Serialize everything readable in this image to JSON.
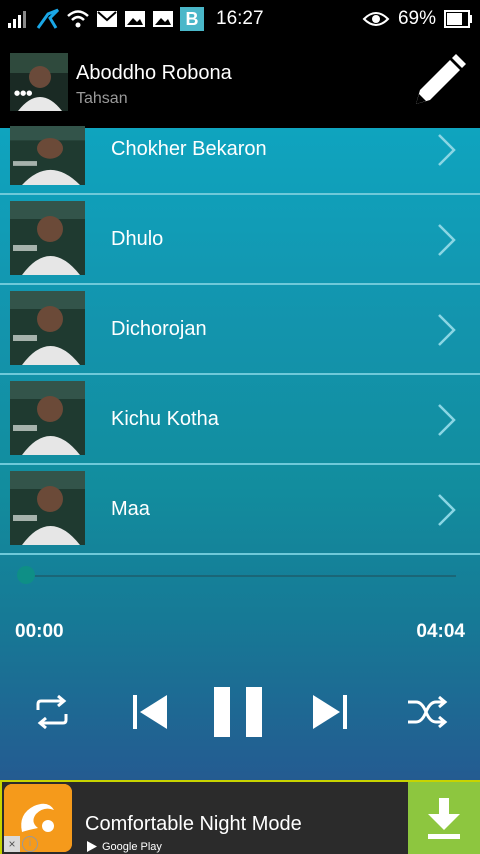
{
  "status_bar": {
    "time": "16:27",
    "battery": "69%",
    "icons": [
      "signal-icon",
      "carrier-icon",
      "wifi-icon",
      "gmail-icon",
      "image-icon",
      "image-icon",
      "b-app-icon",
      "eye-icon",
      "battery-icon"
    ],
    "b_badge": "B"
  },
  "now_playing": {
    "title": "Aboddho Robona",
    "artist": "Tahsan"
  },
  "songs": [
    {
      "title": "Chokher Bekaron"
    },
    {
      "title": "Dhulo"
    },
    {
      "title": "Dichorojan"
    },
    {
      "title": "Kichu Kotha"
    },
    {
      "title": "Maa"
    }
  ],
  "player": {
    "current_time": "00:00",
    "total_time": "04:04",
    "progress": 0
  },
  "ad": {
    "title": "Comfortable Night Mode",
    "store": "Google Play"
  },
  "colors": {
    "accent": "#0fa4bf",
    "download": "#8dc63f"
  }
}
